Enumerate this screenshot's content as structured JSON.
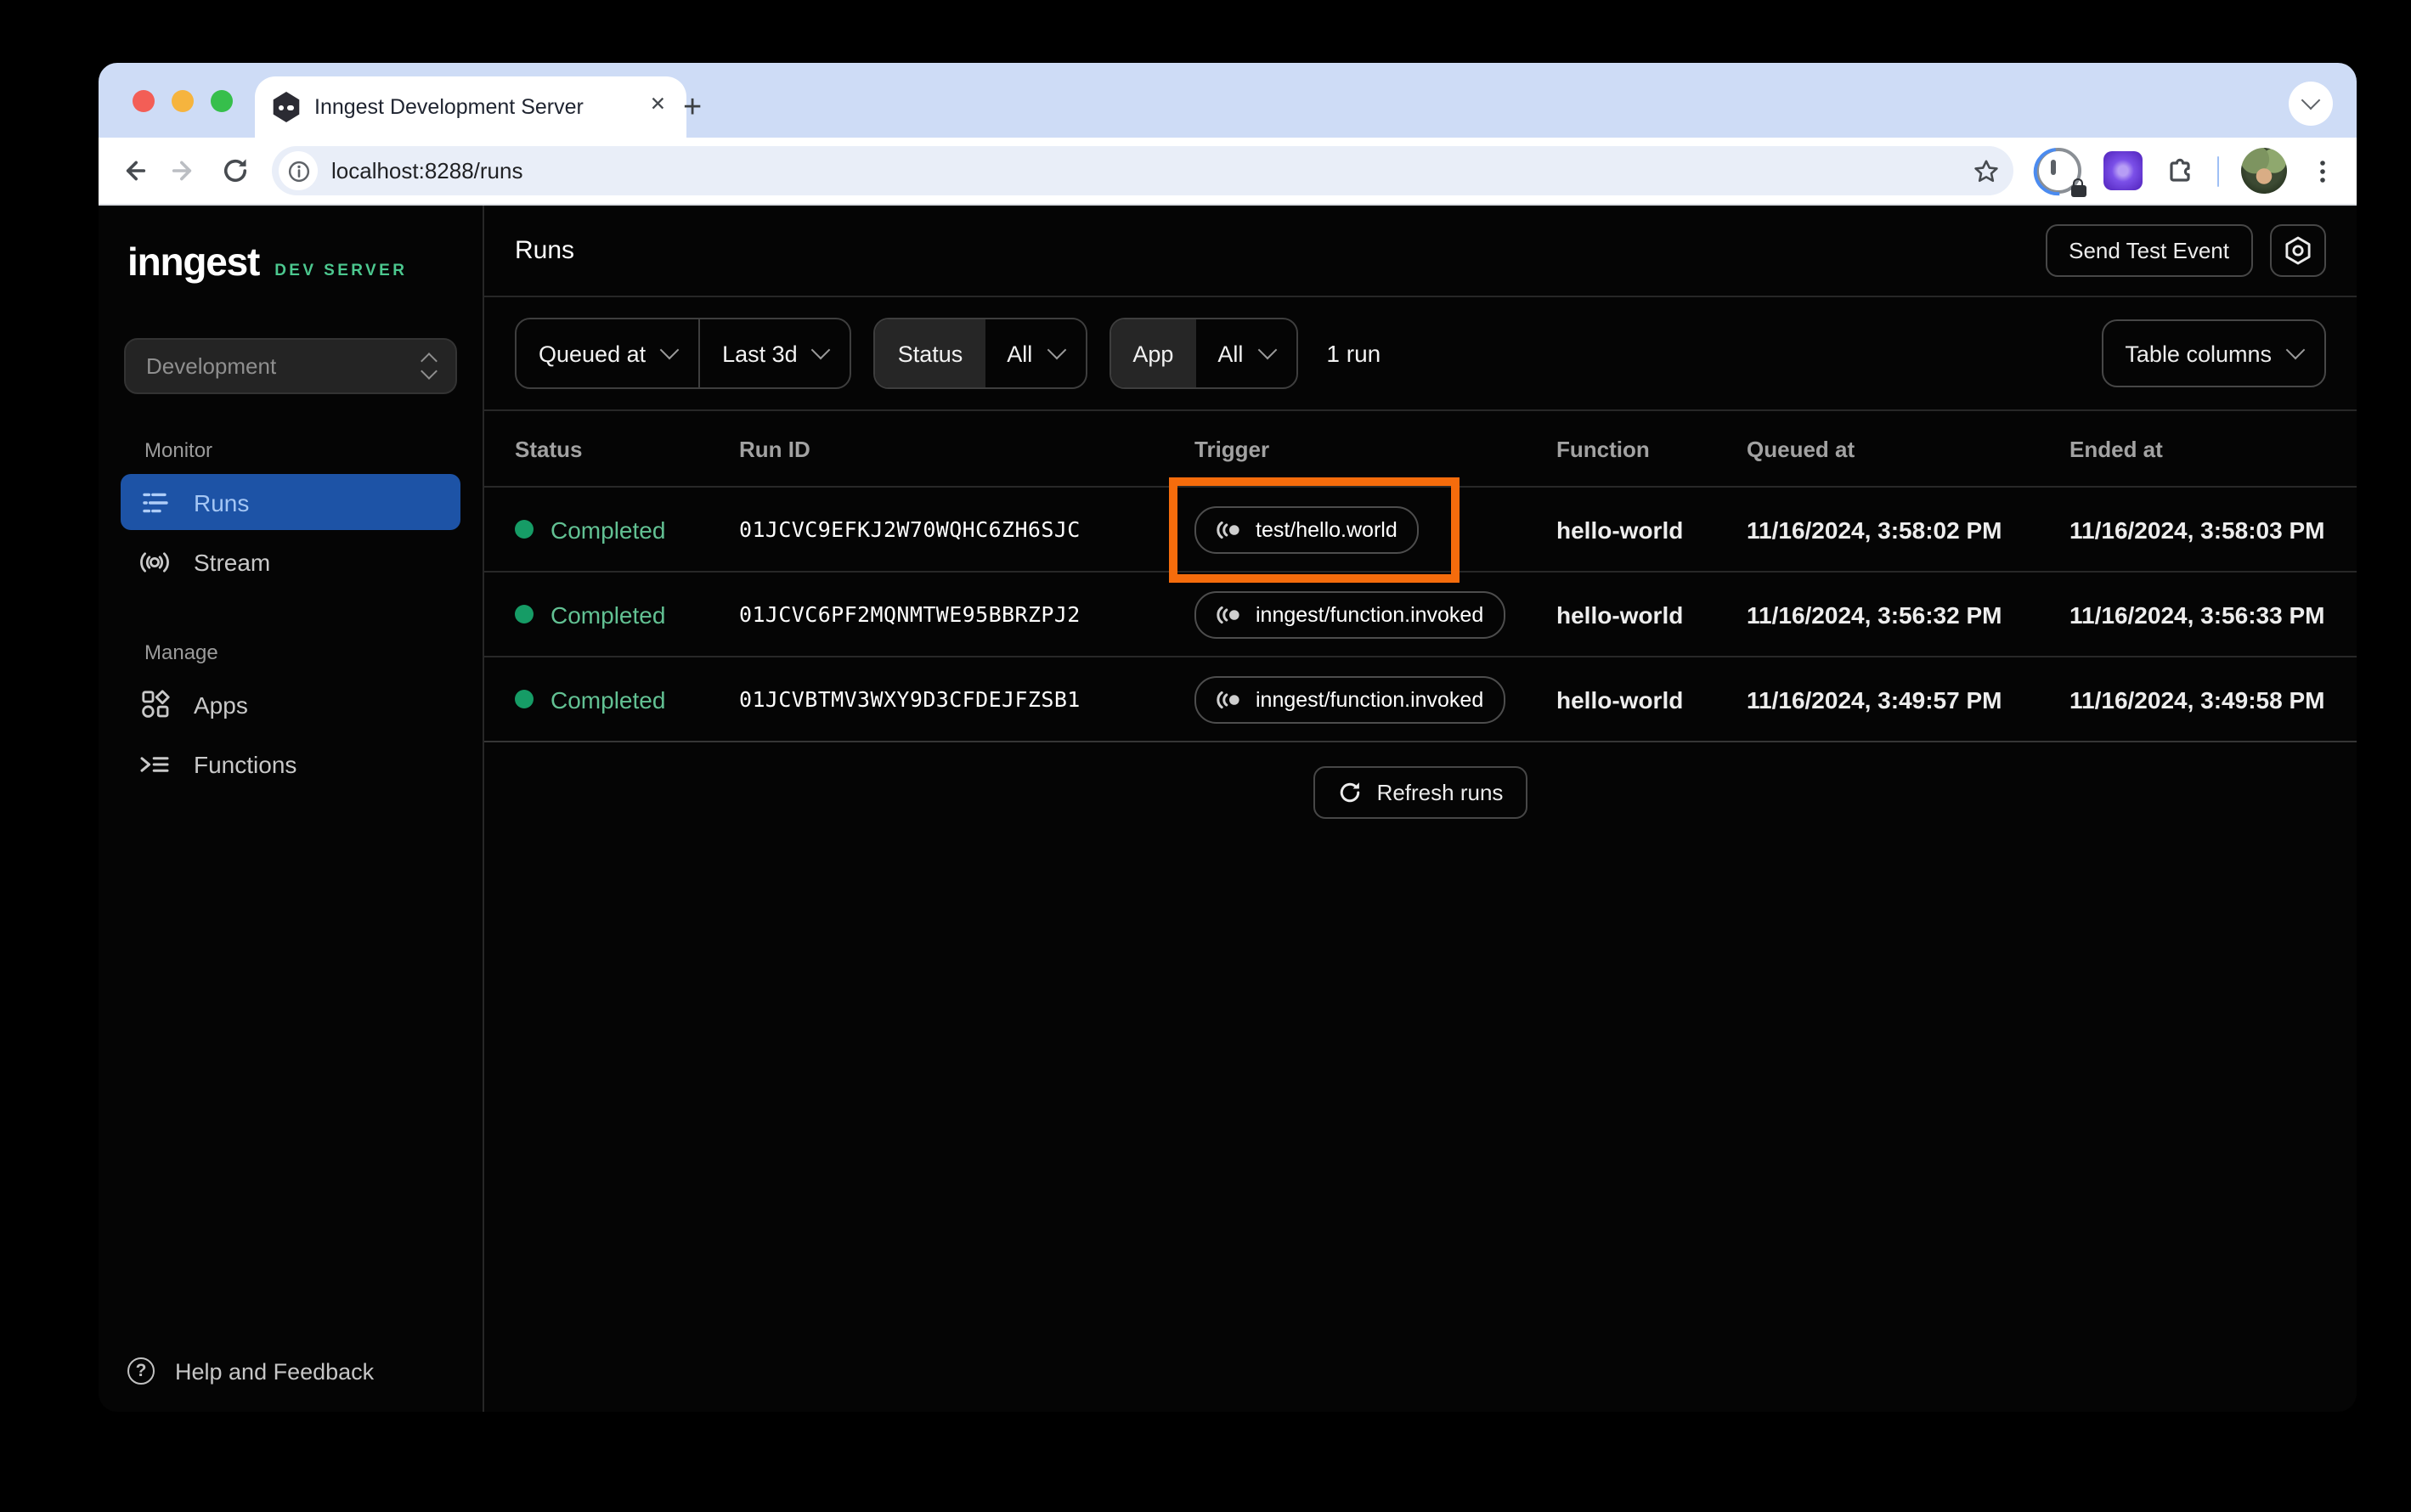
{
  "browser": {
    "tab_title": "Inngest Development Server",
    "close_tab_glyph": "✕",
    "new_tab_glyph": "+",
    "menu_glyph": "⋮",
    "url": "localhost:8288/runs"
  },
  "sidebar": {
    "logo_text": "inngest",
    "logo_badge": "DEV SERVER",
    "environment": "Development",
    "monitor_label": "Monitor",
    "runs_label": "Runs",
    "stream_label": "Stream",
    "manage_label": "Manage",
    "apps_label": "Apps",
    "functions_label": "Functions",
    "help_glyph": "?",
    "help_label": "Help and Feedback"
  },
  "header": {
    "title": "Runs",
    "send_test_event_label": "Send Test Event"
  },
  "filters": {
    "field": "Queued at",
    "range": "Last 3d",
    "status_label": "Status",
    "status_value": "All",
    "app_label": "App",
    "app_value": "All",
    "result_count": "1 run",
    "table_columns_label": "Table columns"
  },
  "table": {
    "columns": [
      "Status",
      "Run ID",
      "Trigger",
      "Function",
      "Queued at",
      "Ended at"
    ],
    "rows": [
      {
        "status": "Completed",
        "run_id": "01JCVC9EFKJ2W70WQHC6ZH6SJC",
        "trigger": "test/hello.world",
        "function": "hello-world",
        "queued_at": "11/16/2024, 3:58:02 PM",
        "ended_at": "11/16/2024, 3:58:03 PM",
        "highlighted": true
      },
      {
        "status": "Completed",
        "run_id": "01JCVC6PF2MQNMTWE95BBRZPJ2",
        "trigger": "inngest/function.invoked",
        "function": "hello-world",
        "queued_at": "11/16/2024, 3:56:32 PM",
        "ended_at": "11/16/2024, 3:56:33 PM",
        "highlighted": false
      },
      {
        "status": "Completed",
        "run_id": "01JCVBTMV3WXY9D3CFDEJFZSB1",
        "trigger": "inngest/function.invoked",
        "function": "hello-world",
        "queued_at": "11/16/2024, 3:49:57 PM",
        "ended_at": "11/16/2024, 3:49:58 PM",
        "highlighted": false
      }
    ],
    "refresh_label": "Refresh runs"
  },
  "colors": {
    "accent_blue": "#1d53a6",
    "accent_blue_text": "#a4c6f4",
    "brand_green": "#4cc88f",
    "completed_green": "#62c193",
    "completed_dot": "#169c66",
    "highlight_orange": "#f56c0c",
    "tabstrip_blue": "#cedcf6",
    "traffic_red": "#f35e56",
    "traffic_yellow": "#f6b43e",
    "traffic_green": "#36bf4b"
  }
}
